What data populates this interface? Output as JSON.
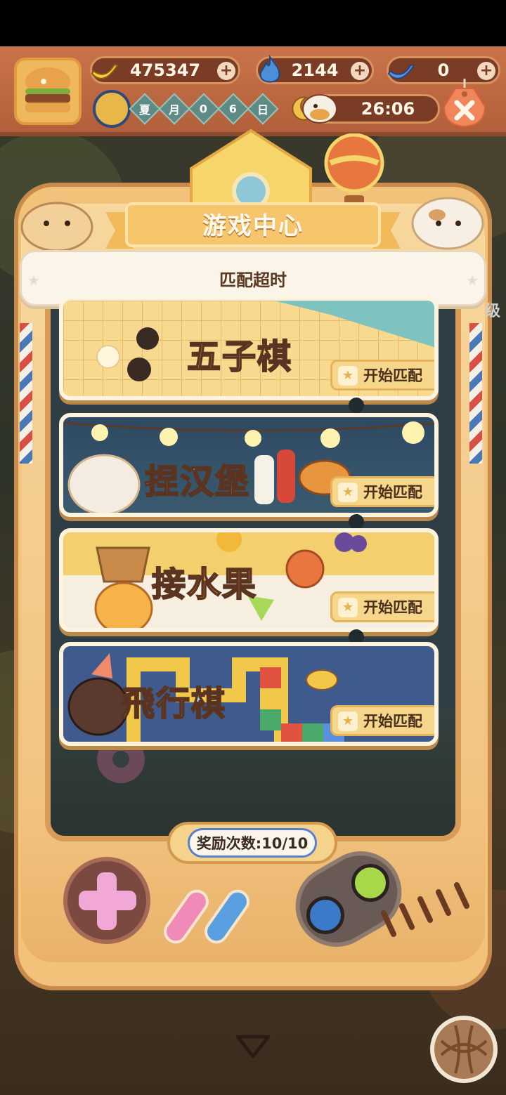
{
  "hud": {
    "bananas": "475347",
    "flames": "2144",
    "blue_bananas": "0",
    "date_chars": [
      "夏",
      "月",
      "0",
      "6",
      "日"
    ],
    "timer": "26:06"
  },
  "panel": {
    "title": "游戏中心",
    "toast": "匹配超时"
  },
  "games": [
    {
      "title": "五子棋",
      "button": "开始匹配"
    },
    {
      "title": "捏汉堡",
      "button": "开始匹配"
    },
    {
      "title": "接水果",
      "button": "开始匹配"
    },
    {
      "title": "飛行棋",
      "button": "开始匹配"
    }
  ],
  "reward": {
    "label": "奖励次数:10/10"
  },
  "side_label": "级",
  "icons": [
    "banana-icon",
    "flame-icon",
    "blue-banana-icon",
    "plus-icon",
    "close-icon",
    "moon-icon",
    "star-icon",
    "chevron-down-icon",
    "yarn-icon"
  ],
  "colors": {
    "accent": "#f5d68b",
    "hud": "#c9734a",
    "card_border": "#fdf3df"
  }
}
